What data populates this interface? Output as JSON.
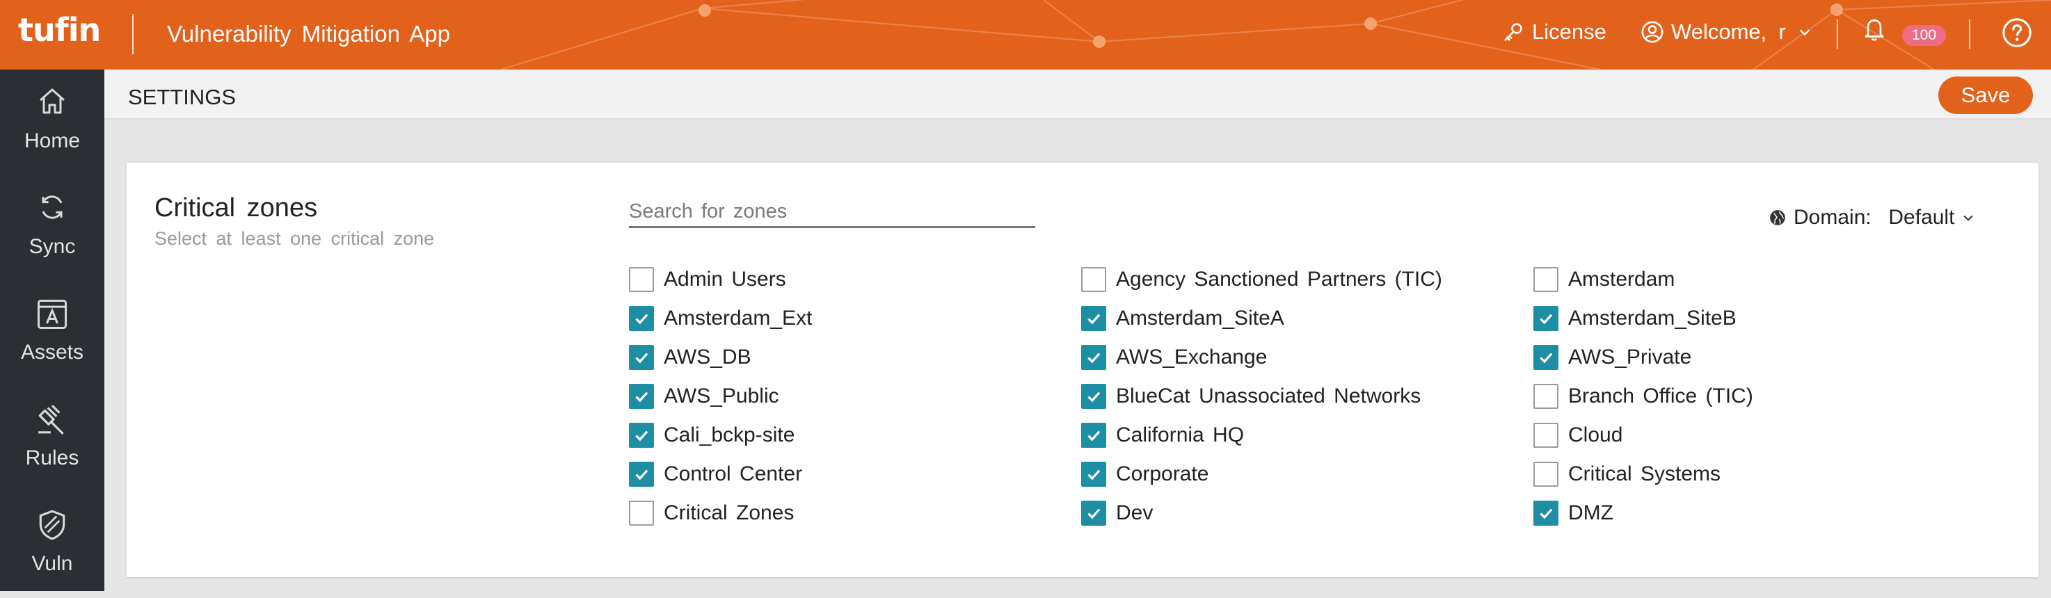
{
  "header": {
    "logo": "tufin",
    "app_title": "Vulnerability Mitigation App",
    "license_label": "License",
    "welcome_label": "Welcome,  r",
    "notification_count": "100",
    "accent_color": "#e2621b"
  },
  "sidebar": {
    "items": [
      {
        "label": "Home",
        "icon": "home-icon"
      },
      {
        "label": "Sync",
        "icon": "sync-icon"
      },
      {
        "label": "Assets",
        "icon": "assets-icon"
      },
      {
        "label": "Rules",
        "icon": "gavel-icon"
      },
      {
        "label": "Vuln",
        "icon": "shield-icon"
      }
    ]
  },
  "settings": {
    "title": "SETTINGS",
    "save_label": "Save"
  },
  "critical_zones": {
    "title": "Critical zones",
    "subtitle": "Select at least one critical zone",
    "search_placeholder": "Search for zones",
    "domain_label": "Domain:  Default",
    "checkbox_color": "#1d8ea4",
    "zones": [
      {
        "label": "Admin Users",
        "checked": false
      },
      {
        "label": "Agency Sanctioned Partners (TIC)",
        "checked": false
      },
      {
        "label": "Amsterdam",
        "checked": false
      },
      {
        "label": "Amsterdam_Ext",
        "checked": true
      },
      {
        "label": "Amsterdam_SiteA",
        "checked": true
      },
      {
        "label": "Amsterdam_SiteB",
        "checked": true
      },
      {
        "label": "AWS_DB",
        "checked": true
      },
      {
        "label": "AWS_Exchange",
        "checked": true
      },
      {
        "label": "AWS_Private",
        "checked": true
      },
      {
        "label": "AWS_Public",
        "checked": true
      },
      {
        "label": "BlueCat Unassociated Networks",
        "checked": true
      },
      {
        "label": "Branch Office (TIC)",
        "checked": false
      },
      {
        "label": "Cali_bckp-site",
        "checked": true
      },
      {
        "label": "California HQ",
        "checked": true
      },
      {
        "label": "Cloud",
        "checked": false
      },
      {
        "label": "Control Center",
        "checked": true
      },
      {
        "label": "Corporate",
        "checked": true
      },
      {
        "label": "Critical Systems",
        "checked": false
      },
      {
        "label": "Critical Zones",
        "checked": false
      },
      {
        "label": "Dev",
        "checked": true
      },
      {
        "label": "DMZ",
        "checked": true
      }
    ]
  }
}
